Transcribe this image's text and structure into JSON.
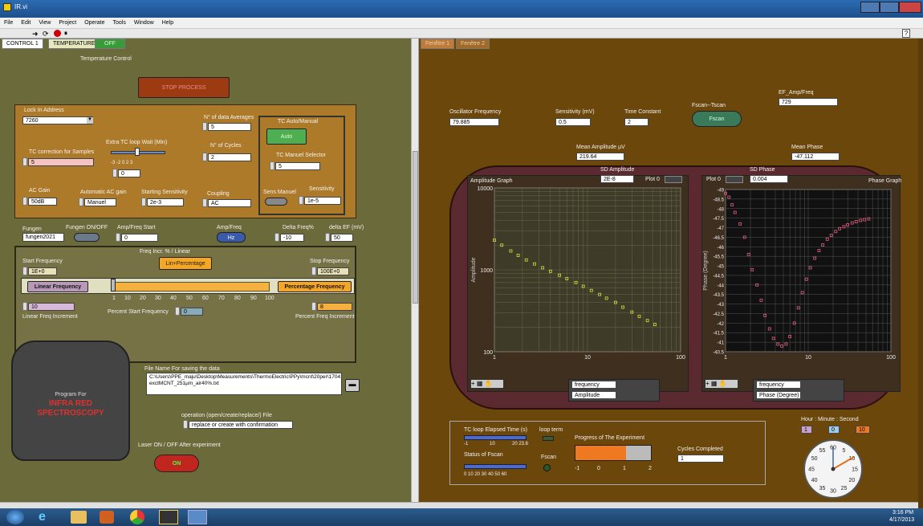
{
  "window": {
    "title": "IR.vi"
  },
  "menu": [
    "File",
    "Edit",
    "View",
    "Project",
    "Operate",
    "Tools",
    "Window",
    "Help"
  ],
  "tabs_left": [
    "CONTROL 1",
    "TEMPERATURE",
    "OFF"
  ],
  "tabs_right": [
    "Fenêtre 1",
    "Fenêtre 2"
  ],
  "left": {
    "temp_control": "Temperature Control",
    "stop_process": "STOP PROCESS",
    "lockin_label": "Lock In Address",
    "lockin_value": "7260",
    "tc_corr_label": "TC correction for Samples",
    "tc_corr_value": "5",
    "extra_tc_label": "Extra TC loop Wait (Min)",
    "extra_tc_ticks": "-3  -2    0     2  3",
    "extra_tc_value": "0",
    "n_avg_label": "N° of data Averages",
    "n_avg_value": "5",
    "n_cycles_label": "N° of Cycles",
    "n_cycles_value": "2",
    "tc_am_label": "TC Auto/Manual",
    "auto_btn": "Auto",
    "tc_manual_label": "TC Manuel Selector",
    "tc_manual_value": "5",
    "sens_manuel": "Sens Manuel",
    "sensitivity_label": "Sensitivity",
    "sensitivity_value": "1e-5",
    "ac_gain_label": "AC Gain",
    "ac_gain_value": "50dB",
    "auto_ac_label": "Automatic AC gain",
    "auto_ac_value": "Manuel",
    "start_sens_label": "Starting Sensitivity",
    "start_sens_value": "2e-3",
    "coupling_label": "Coupling",
    "coupling_value": "AC",
    "fungen_label": "Fungen",
    "fungen_value": "fungen2021",
    "fungen_onoff": "Fungen ON/OFF",
    "ampfreq_start_label": "Amp/Freq Start",
    "ampfreq_start_value": "0",
    "ampfreq_label": "Amp/Freq",
    "hz_btn": "Hz",
    "delta_freq_label": "Delta Freq%",
    "delta_freq_value": "-10",
    "delta_ef_label": "delta EF (mV)",
    "delta_ef_value": "50",
    "freq_incr_label": "Freq Incr. % / Linear",
    "lin_pct_btn": "Lin+Percentage",
    "start_freq_label": "Start Frequency",
    "start_freq_value": "1E+0",
    "stop_freq_label": "Stop Frequency",
    "stop_freq_value": "100E+0",
    "linear_freq": "Linear Frequency",
    "pct_freq": "Percentage Frequency",
    "slider_ticks": [
      "1",
      "10",
      "20",
      "30",
      "40",
      "50",
      "60",
      "70",
      "80",
      "90",
      "100"
    ],
    "lin_incr_value": "10",
    "lin_incr_label": "Linear Freq Increment",
    "pct_start_label": "Percent Start Frequency",
    "pct_start_value": "0",
    "pct_incr_value": "8",
    "pct_incr_label": "Percent Freq Increment",
    "program_for": "Program For",
    "infra_red": "INFRA RED",
    "spectroscopy": "SPECTROSCOPY",
    "file_name_label": "File Name For saving the data",
    "file_path": "C:\\Users\\PPE_maju\\Desktop\\Measurements\\ThermoElectric\\PPy\\mcnt\\20per\\170413\\PPy20%-exctMCNT_251µm_air40%.txt",
    "operation_label": "operation (open/create/replace/) File",
    "operation_value": "replace or create with confirmation",
    "laser_label": "Laser ON / OFF After experiment",
    "on_btn": "ON"
  },
  "right": {
    "ef_label": "EF_Amp/Freq",
    "ef_value": "729",
    "osc_label": "Oscillator Frequency",
    "osc_value": "79.885",
    "sens_label": "Sensitivity (mV)",
    "sens_value": "0.5",
    "tc_label": "Time Constant",
    "tc_value": "2",
    "fscan_tscan": "Fscan--Tscan",
    "fscan_btn": "Fscan",
    "mean_amp_label": "Mean Amplitude µV",
    "mean_amp_value": "219.64",
    "mean_phase_label": "Mean Phase",
    "mean_phase_value": "-47.112",
    "sd_amp_label": "SD Amplitude",
    "sd_amp_value": "2E-8",
    "sd_phase_label": "SD Phase",
    "sd_phase_value": "0.004",
    "plot0": "Plot 0",
    "amp_graph_title": "Amplitude Graph",
    "phase_graph_title": "Phase Graph",
    "amp_y_label": "Amplitude",
    "phase_y_label": "Phase (Degree)",
    "x_label": "frequency",
    "legend_x": "frequency",
    "legend_amp": "Amplitude",
    "legend_phase": "Phase (Degree)",
    "tc_elapsed_label": "TC loop Elapsed Time (s)",
    "tc_ticks": [
      "-1",
      "10",
      "20 23.6"
    ],
    "loop_term": "loop term",
    "progress_label": "Progress of The Experiment",
    "progress_ticks": [
      "-1",
      "0",
      "1",
      "2"
    ],
    "cycles_label": "Cycles Completed",
    "cycles_value": "1",
    "status_label": "Status of Fscan",
    "status_ticks": "0  10  20  30  40  50  60",
    "fscan_led": "Fscan",
    "hms_label": "Hour : Minute : Second",
    "hour": "1",
    "minute": "0",
    "second": "10",
    "clock_ticks": [
      "60",
      "5",
      "10",
      "15",
      "20",
      "25",
      "30",
      "35",
      "40",
      "45",
      "50",
      "55"
    ]
  },
  "chart_data": [
    {
      "type": "scatter",
      "title": "Amplitude Graph",
      "xlabel": "frequency",
      "ylabel": "Amplitude",
      "xscale": "log",
      "yscale": "log",
      "xlim": [
        1,
        100
      ],
      "ylim": [
        100,
        10000
      ],
      "x": [
        1,
        1.2,
        1.5,
        1.8,
        2.2,
        2.7,
        3.3,
        4,
        5,
        6,
        7.5,
        9,
        11,
        13.5,
        16,
        20,
        24,
        30,
        36,
        44,
        53
      ],
      "y": [
        2300,
        2000,
        1700,
        1500,
        1320,
        1180,
        1060,
        960,
        860,
        780,
        700,
        630,
        560,
        500,
        450,
        400,
        350,
        305,
        270,
        240,
        215
      ]
    },
    {
      "type": "scatter",
      "title": "Phase Graph",
      "xlabel": "frequency",
      "ylabel": "Phase (Degree)",
      "xscale": "log",
      "ylim": [
        -49,
        -40.5
      ],
      "x": [
        1,
        1.1,
        1.2,
        1.3,
        1.5,
        1.7,
        1.9,
        2.1,
        2.4,
        2.7,
        3,
        3.4,
        3.8,
        4.3,
        4.8,
        5.4,
        6,
        6.8,
        7.6,
        8.5,
        9.5,
        10.6,
        12,
        13.5,
        15,
        17,
        19,
        21.5,
        24,
        27,
        30,
        34,
        38,
        43,
        48,
        54
      ],
      "y": [
        -48.8,
        -48.6,
        -48.2,
        -47.8,
        -47.2,
        -46.5,
        -45.6,
        -44.8,
        -44,
        -43.2,
        -42.4,
        -41.7,
        -41.2,
        -40.9,
        -40.8,
        -40.9,
        -41.3,
        -42,
        -42.8,
        -43.6,
        -44.3,
        -44.9,
        -45.4,
        -45.8,
        -46.1,
        -46.4,
        -46.6,
        -46.8,
        -46.95,
        -47.05,
        -47.15,
        -47.25,
        -47.32,
        -47.38,
        -47.42,
        -47.46
      ]
    }
  ],
  "taskbar": {
    "time": "3:16 PM",
    "date": "4/17/2013"
  }
}
